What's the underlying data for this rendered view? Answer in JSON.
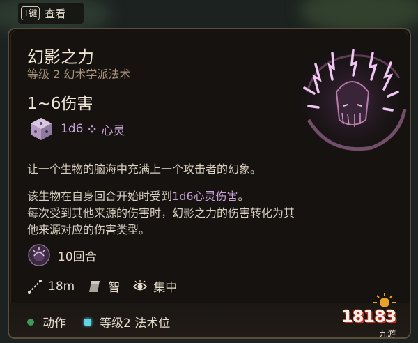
{
  "hint": {
    "key": "T键",
    "label": "查看"
  },
  "spell": {
    "name": "幻影之力",
    "subtitle": "等级 2 幻术学派法术",
    "damage_heading": "1~6伤害",
    "dice": "1d6",
    "damage_type": "心灵",
    "description_1": "让一个生物的脑海中充满上一个攻击者的幻象。",
    "description_2_pre": "该生物在自身回合开始时受到",
    "description_2_highlight": "1d6心灵伤害",
    "description_2_post": "。",
    "description_3": "每次受到其他来源的伤害时，幻影之力的伤害转化为其",
    "description_4": "他来源对应的伤害类型。"
  },
  "duration": {
    "text": "10回合",
    "icon": "duration-icon"
  },
  "stats": {
    "range": "18m",
    "save": "智",
    "concentration": "集中"
  },
  "cost": {
    "action": "动作",
    "slot": "等级2 法术位"
  },
  "watermark": {
    "number": "18183",
    "sub": "九游"
  },
  "colors": {
    "accent_purple": "#c9a1d6",
    "subtitle_tan": "#a8937b",
    "action_green": "#3f9a55",
    "slot_cyan": "#5fd6e8",
    "panel_border": "#5a4c3b"
  }
}
